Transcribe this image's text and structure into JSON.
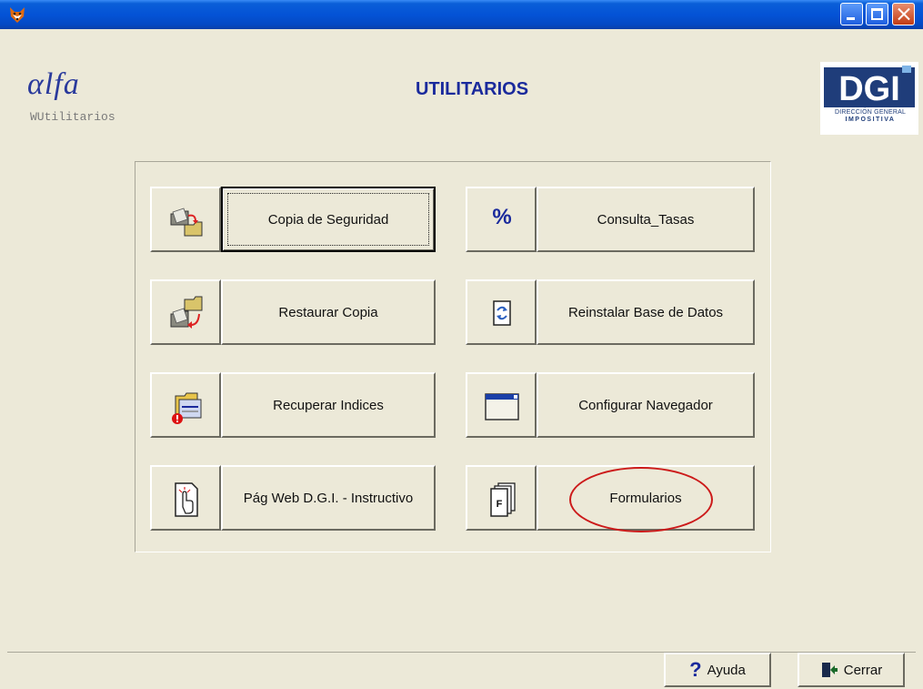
{
  "window": {
    "app_icon": "fox-icon",
    "controls": [
      "minimize-icon",
      "maximize-icon",
      "close-icon"
    ]
  },
  "header": {
    "logo_text": "αlfa",
    "module_name": "WUtilitarios",
    "title": "UTILITARIOS",
    "dgi_logo_text": "DGI",
    "dgi_caption_line1": "DIRECCIÓN GENERAL",
    "dgi_caption_line2": "IMPOSITIVA"
  },
  "utilities": [
    {
      "label": "Copia de Seguridad",
      "icon": "backup-folders-icon"
    },
    {
      "label": "Consulta_Tasas",
      "icon": "percent-icon"
    },
    {
      "label": "Restaurar Copia",
      "icon": "restore-folders-icon"
    },
    {
      "label": "Reinstalar Base de Datos",
      "icon": "reinstall-database-icon"
    },
    {
      "label": "Recuperar Indices",
      "icon": "recover-indexes-icon"
    },
    {
      "label": "Configurar Navegador",
      "icon": "browser-window-icon"
    },
    {
      "label": "Pág Web D.G.I. - Instructivo",
      "icon": "web-page-hand-icon"
    },
    {
      "label": "Formularios",
      "icon": "forms-stack-icon"
    }
  ],
  "footer": {
    "help_label": "Ayuda",
    "close_label": "Cerrar"
  },
  "colors": {
    "titlebar": "#0453d6",
    "background": "#ece9d8",
    "title_text": "#1a2a9c",
    "highlight_ellipse": "#cc1a1a"
  }
}
